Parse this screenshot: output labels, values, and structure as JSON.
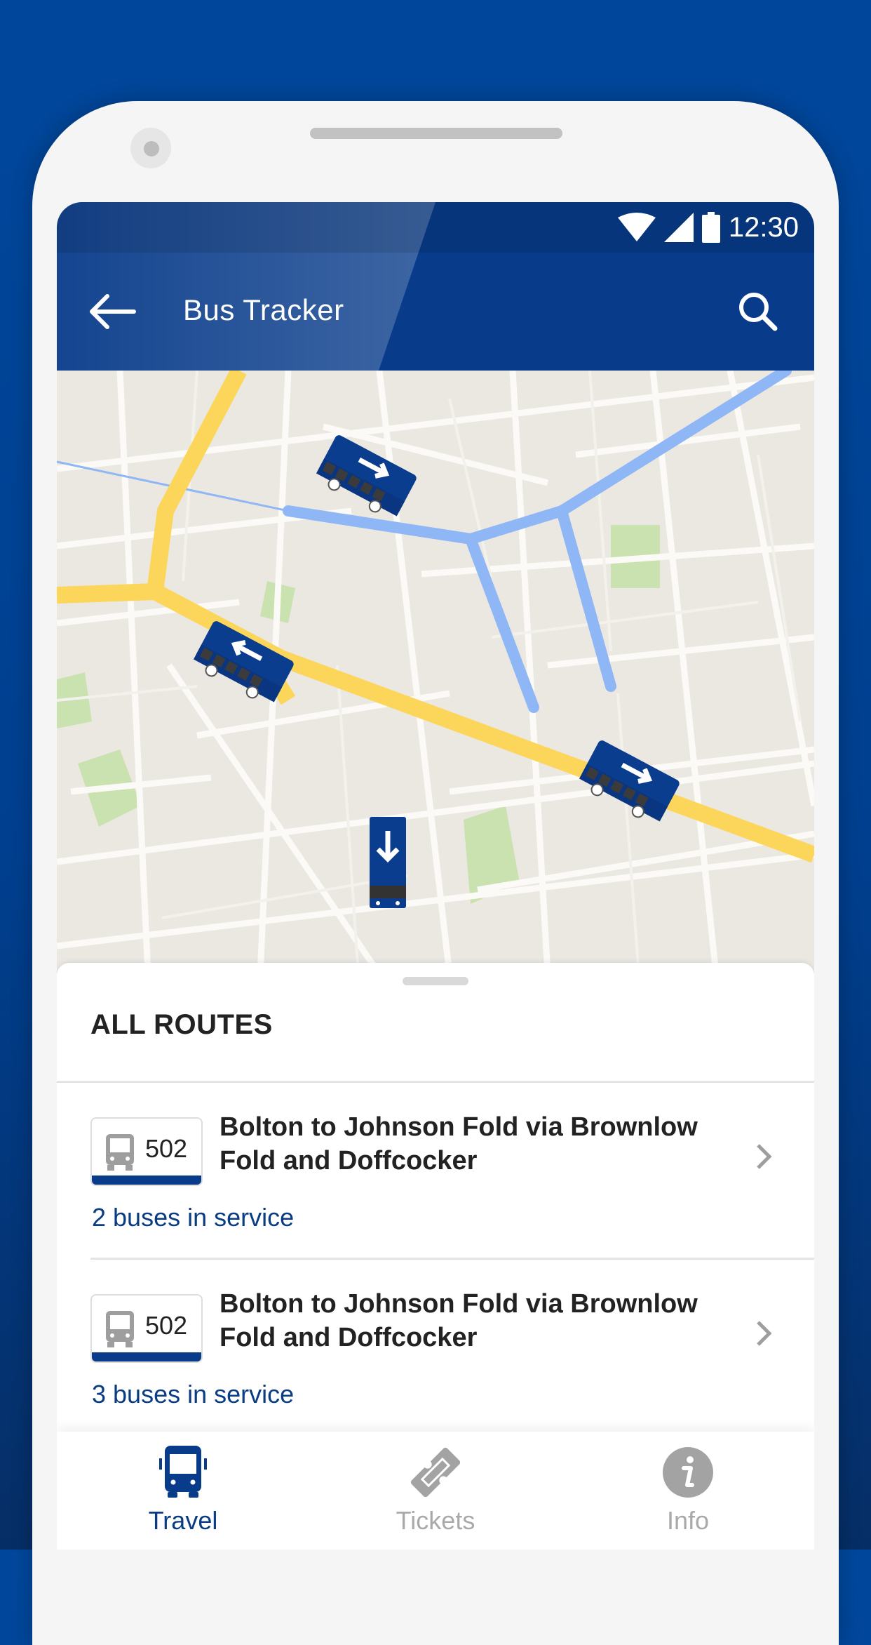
{
  "status_bar": {
    "time": "12:30",
    "icons": [
      "wifi-icon",
      "signal-icon",
      "battery-icon"
    ]
  },
  "app_bar": {
    "title": "Bus Tracker",
    "back_icon": "arrow-back-icon",
    "search_icon": "search-icon"
  },
  "map": {
    "bus_markers": [
      {
        "direction": "down-right"
      },
      {
        "direction": "up-left"
      },
      {
        "direction": "down-right"
      },
      {
        "direction": "down"
      }
    ]
  },
  "routes_panel": {
    "title": "ALL ROUTES",
    "routes": [
      {
        "number": "502",
        "name": "Bolton to Johnson Fold via Brownlow Fold and Doffcocker",
        "status": "2 buses in service"
      },
      {
        "number": "502",
        "name": "Bolton to Johnson Fold via Brownlow Fold and Doffcocker",
        "status": "3 buses in service"
      }
    ]
  },
  "bottom_nav": {
    "items": [
      {
        "label": "Travel",
        "icon": "bus-icon",
        "active": true
      },
      {
        "label": "Tickets",
        "icon": "ticket-icon",
        "active": false
      },
      {
        "label": "Info",
        "icon": "info-icon",
        "active": false
      }
    ]
  },
  "colors": {
    "primary": "#083b8a",
    "accent_text": "#0a3c84",
    "inactive": "#a9a9a9",
    "background": "#00479c"
  }
}
